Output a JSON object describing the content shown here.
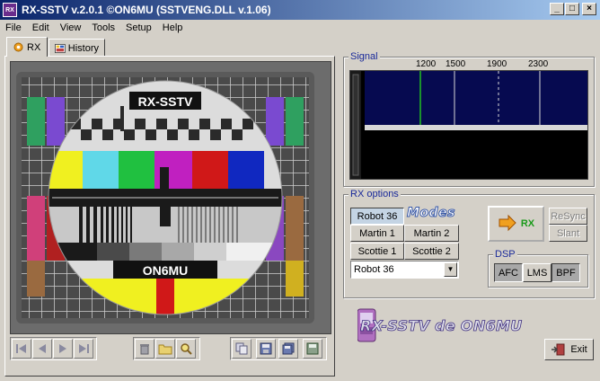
{
  "window": {
    "title": "RX-SSTV v.2.0.1 ©ON6MU (SSTVENG.DLL v.1.06)",
    "icon_text": "RX",
    "buttons": [
      "_",
      "□",
      "×"
    ]
  },
  "menu": [
    "File",
    "Edit",
    "View",
    "Tools",
    "Setup",
    "Help"
  ],
  "tabs": [
    {
      "label": "RX",
      "icon": "gear-icon",
      "active": true
    },
    {
      "label": "History",
      "icon": "history-icon",
      "active": false
    }
  ],
  "image": {
    "top_label": "RX-SSTV",
    "bottom_label": "ON6MU"
  },
  "signal": {
    "label": "Signal",
    "freq_labels": [
      "1200",
      "1500",
      "1900",
      "2300"
    ]
  },
  "rx_options": {
    "label": "RX options",
    "modes_logo": "Modes",
    "modes": [
      "Robot 36",
      "Modes",
      "Martin 1",
      "Martin 2",
      "Scottie 1",
      "Scottie 2"
    ],
    "selected": "Robot 36",
    "select_value": "Robot 36"
  },
  "controls": {
    "rx_label": "RX",
    "resync_label": "ReSync",
    "slant_label": "Slant"
  },
  "dsp": {
    "label": "DSP",
    "buttons": [
      "AFC",
      "LMS",
      "BPF"
    ],
    "active": [
      "LMS"
    ]
  },
  "brand_text": "RX-SSTV de ON6MU",
  "exit_label": "Exit",
  "colors": {
    "title_start": "#0a246a",
    "title_end": "#a6caf0",
    "group_label": "#1a2a9a",
    "rx_green": "#1a9a1a"
  }
}
